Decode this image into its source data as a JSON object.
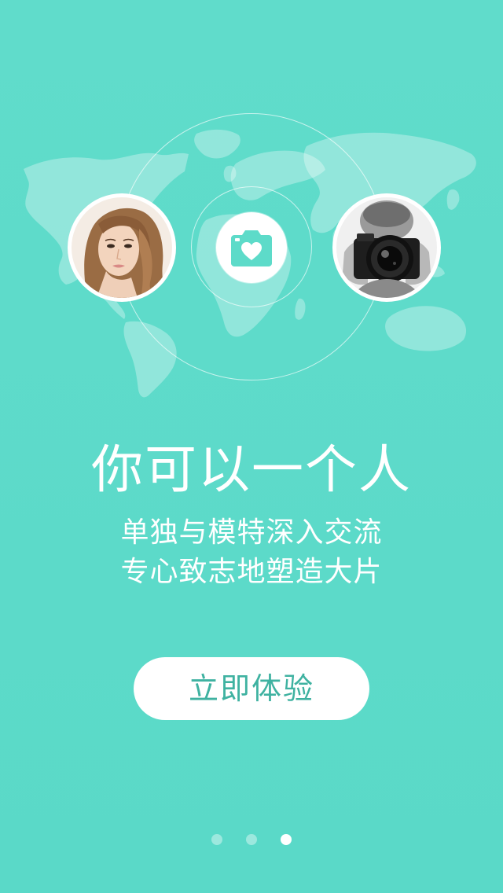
{
  "onboarding": {
    "headline": "你可以一个人",
    "subline_1": "单独与模特深入交流",
    "subline_2": "专心致志地塑造大片",
    "cta_label": "立即体验"
  },
  "pager": {
    "page_count": 3,
    "active_index": 2
  },
  "icons": {
    "center": "camera-heart-icon",
    "left_avatar": "model-portrait",
    "right_avatar": "photographer-portrait"
  },
  "colors": {
    "background": "#5ddbc9",
    "accent_text": "#3fb2a1",
    "foreground": "#ffffff"
  }
}
